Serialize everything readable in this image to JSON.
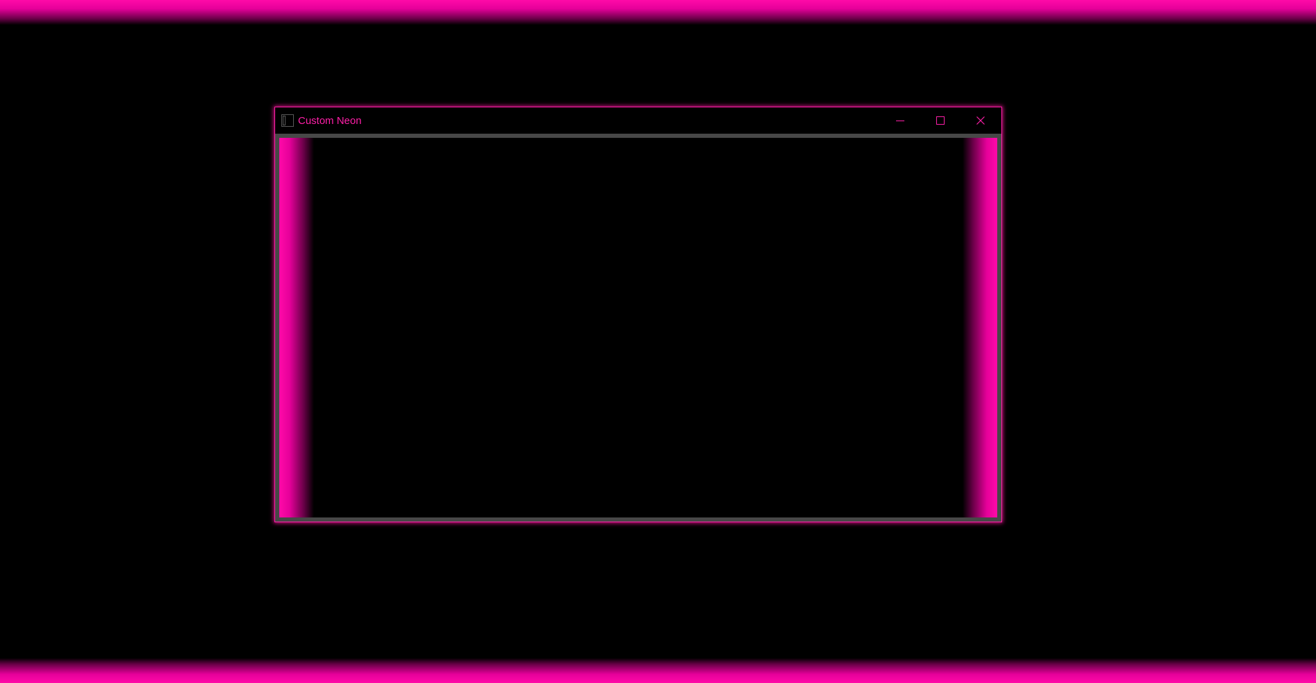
{
  "window": {
    "title": "Custom Neon",
    "icons": {
      "app": "window-app-icon",
      "minimize": "minimize-icon",
      "maximize": "maximize-icon",
      "close": "close-icon"
    }
  },
  "theme": {
    "accent": "#ff1fa8",
    "glow": "#ff0aa8",
    "frame": "#474747",
    "background": "#000000"
  }
}
